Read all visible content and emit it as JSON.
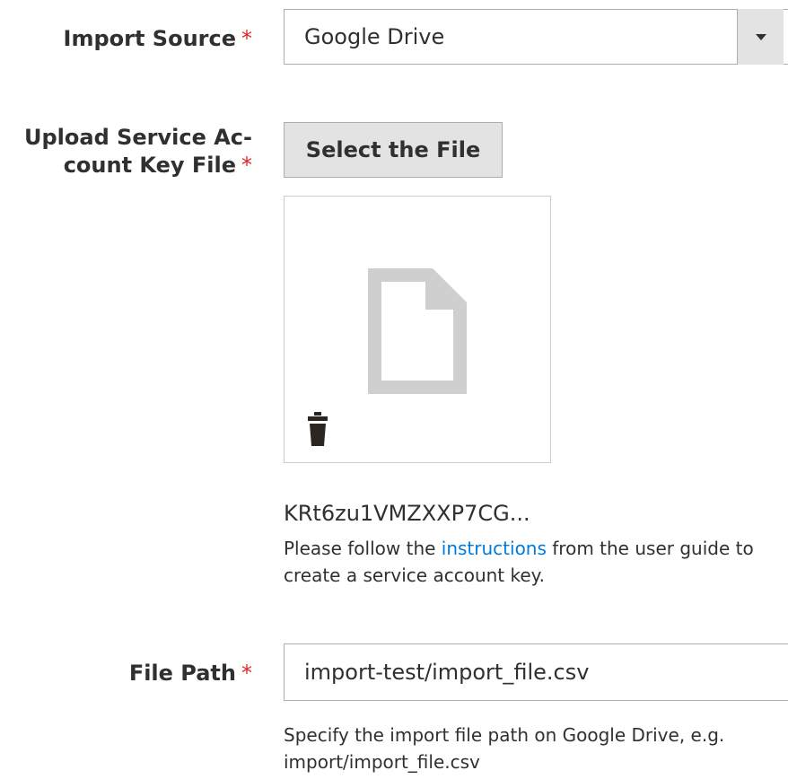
{
  "import_source": {
    "label": "Import Source",
    "required_mark": "*",
    "selected": "Google Drive",
    "arrow_icon": "triangle-down-icon"
  },
  "upload": {
    "label_line1": "Upload Service Ac-",
    "label_line2": "count Key File",
    "required_mark": "*",
    "button_label": "Select the File",
    "file_icon": "document-icon",
    "delete_icon": "trash-icon",
    "filename": "KRt6zu1VMZXXP7CG...",
    "note_before": "Please follow the ",
    "note_link": "instructions",
    "note_after": " from the user guide to create a service account key."
  },
  "file_path": {
    "label": "File Path",
    "required_mark": "*",
    "value": "import-test/import_file.csv",
    "note": "Specify the import file path on Google Drive, e.g. import/import_file.csv"
  },
  "colors": {
    "required": "#e22626",
    "link": "#007bdb",
    "border": "#adadad",
    "button_bg": "#e3e3e3"
  }
}
